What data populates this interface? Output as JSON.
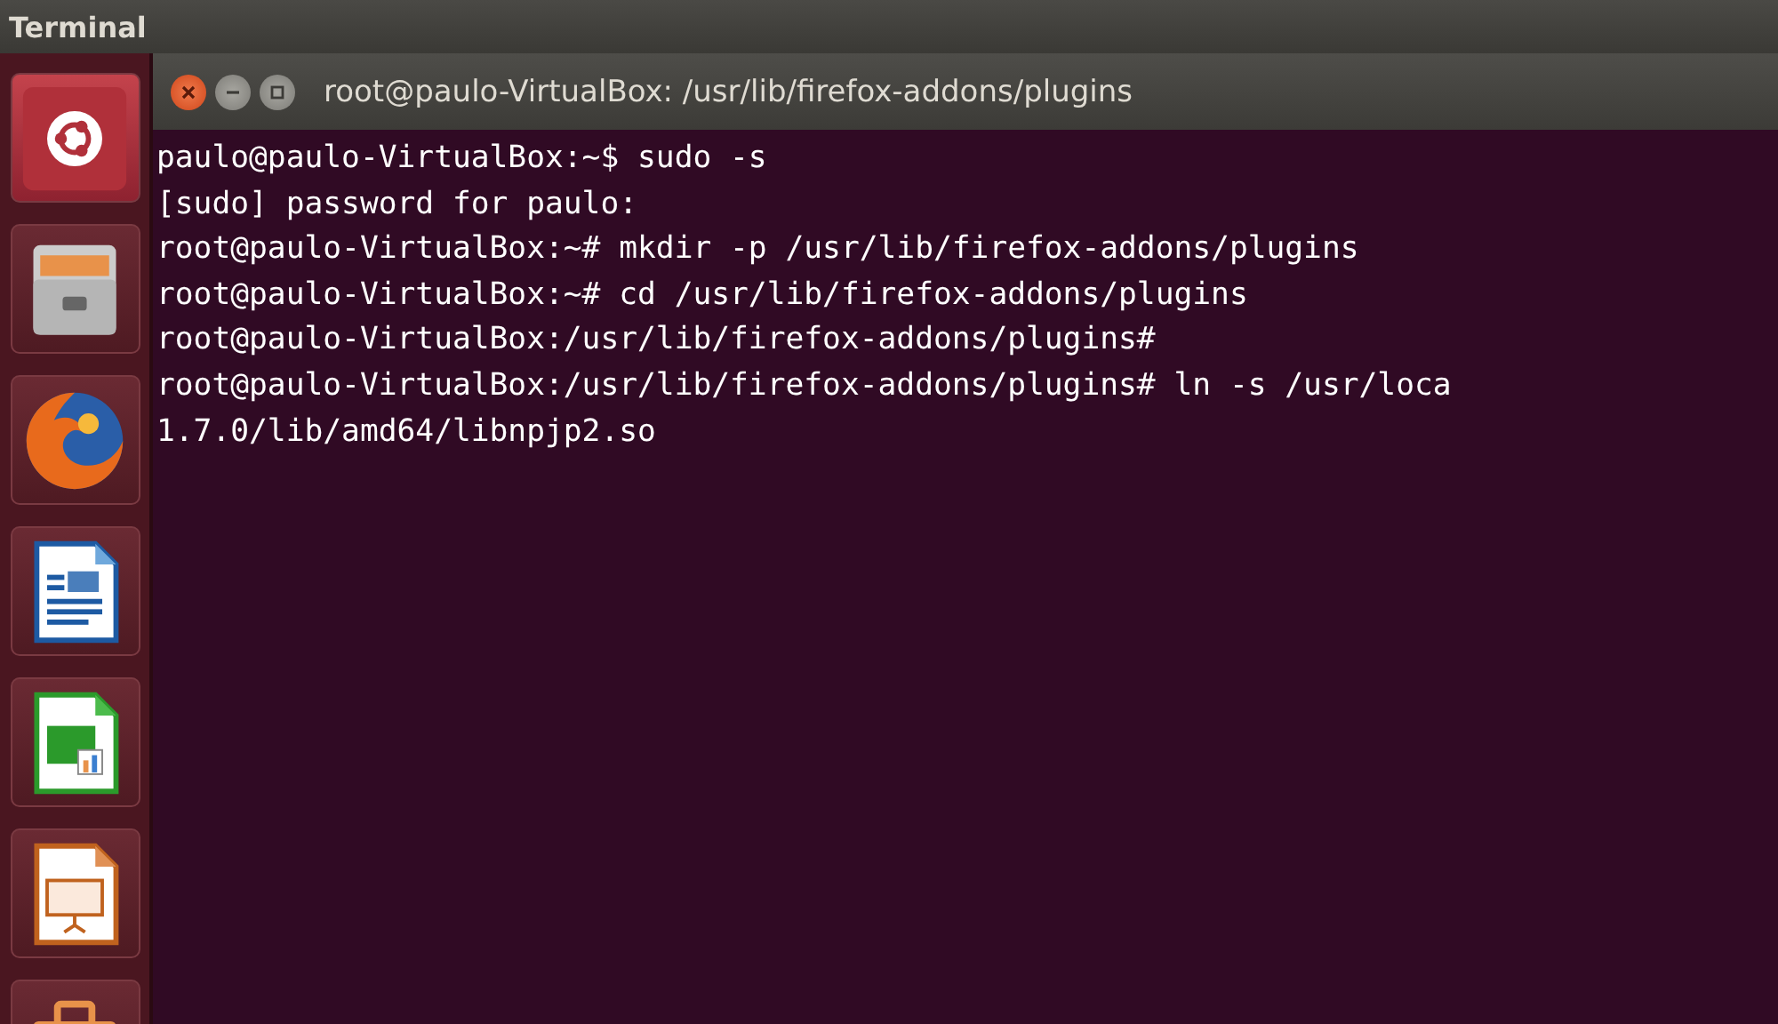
{
  "top_panel": {
    "title": "Terminal"
  },
  "launcher": {
    "items": [
      {
        "kind": "dash"
      },
      {
        "kind": "files"
      },
      {
        "kind": "browser"
      },
      {
        "kind": "writer"
      },
      {
        "kind": "calc"
      },
      {
        "kind": "impress"
      },
      {
        "kind": "toolbox"
      }
    ]
  },
  "window": {
    "title": "root@paulo-VirtualBox: /usr/lib/firefox-addons/plugins",
    "controls": [
      {
        "kind": "close"
      },
      {
        "kind": "minimize"
      },
      {
        "kind": "maximize"
      }
    ]
  },
  "terminal": {
    "lines": [
      "paulo@paulo-VirtualBox:~$ sudo -s",
      "[sudo] password for paulo:",
      "root@paulo-VirtualBox:~# mkdir -p /usr/lib/firefox-addons/plugins",
      "root@paulo-VirtualBox:~# cd /usr/lib/firefox-addons/plugins",
      "root@paulo-VirtualBox:/usr/lib/firefox-addons/plugins#",
      "root@paulo-VirtualBox:/usr/lib/firefox-addons/plugins# ln -s /usr/loca",
      "1.7.0/lib/amd64/libnpjp2.so"
    ]
  }
}
